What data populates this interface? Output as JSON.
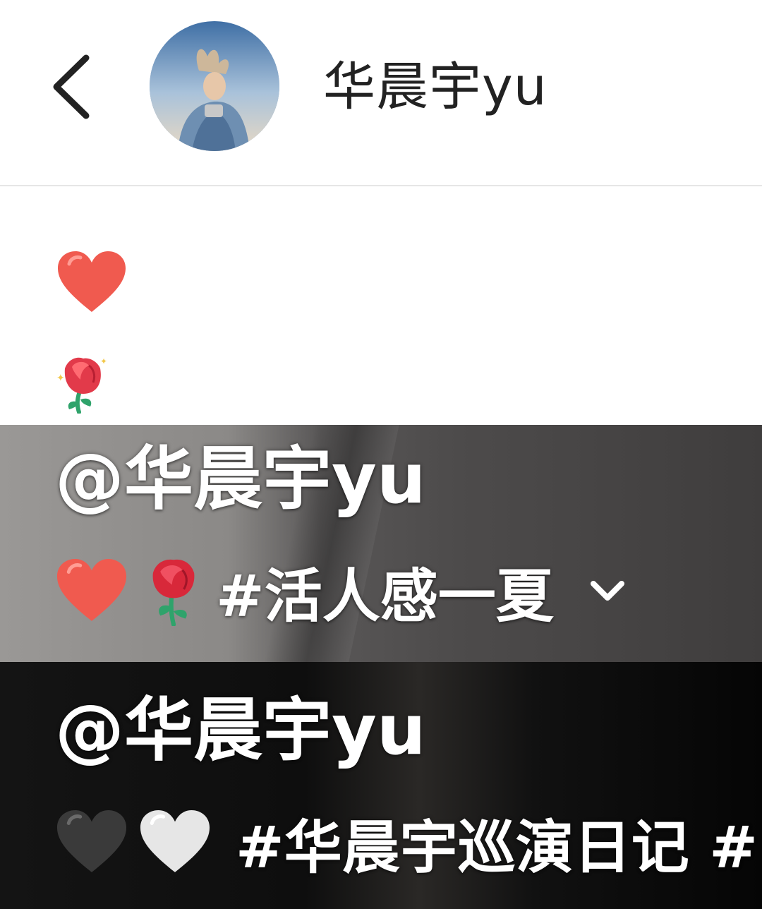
{
  "header": {
    "username": "华晨宇yu",
    "back_icon": "chevron-left-icon",
    "avatar_alt": ""
  },
  "post": {
    "lines": [
      {
        "icon": "red-heart-icon"
      },
      {
        "icon": "rose-icon"
      }
    ]
  },
  "videos": [
    {
      "author": "@华晨宇yu",
      "emojis": [
        "red-heart-icon",
        "rose-icon"
      ],
      "hashtag": "#活人感一夏",
      "has_expand": true
    },
    {
      "author": "@华晨宇yu",
      "emojis": [
        "black-heart-icon",
        "white-heart-icon"
      ],
      "hashtag": "#华晨宇巡演日记 #",
      "has_expand": false
    }
  ],
  "colors": {
    "heart_red": "#f05a4f",
    "rose_red": "#e23a4a",
    "stem_green": "#2fa36b",
    "header_text": "#222222",
    "divider": "#e6e6e6"
  }
}
